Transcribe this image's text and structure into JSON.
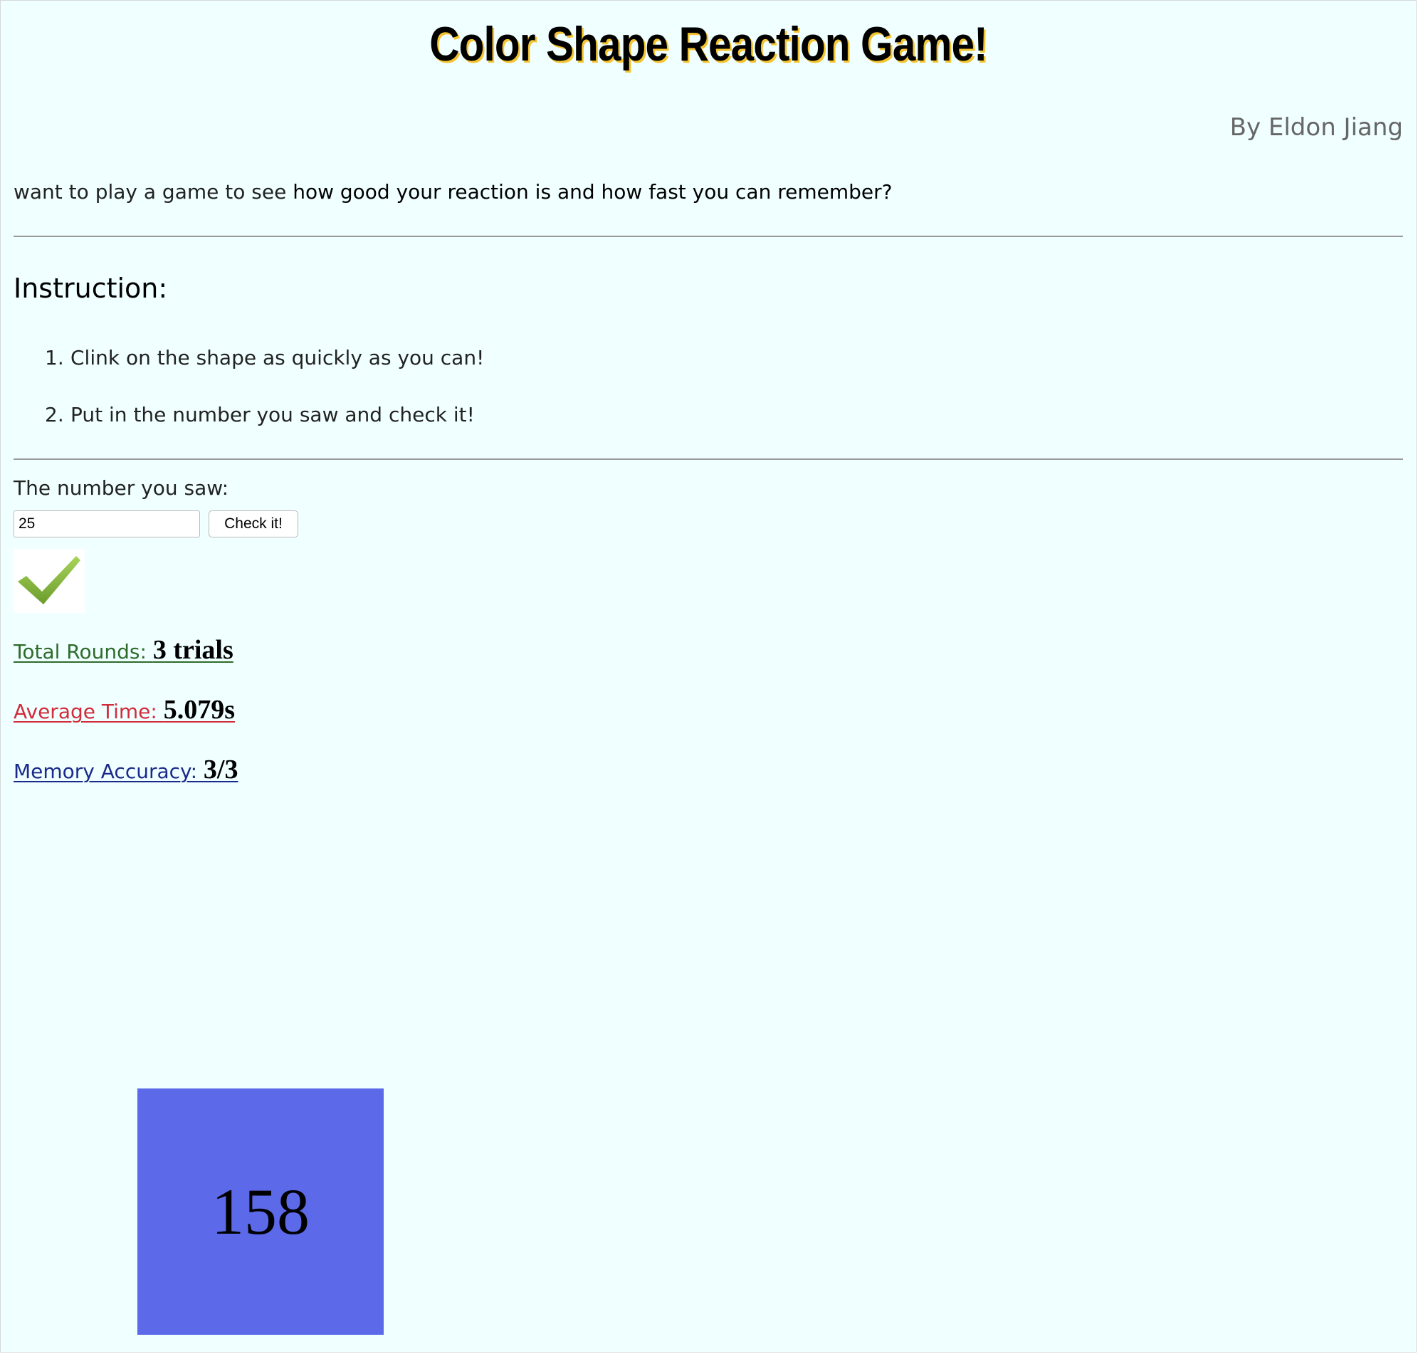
{
  "header": {
    "title": "Color Shape Reaction Game!",
    "byline": "By Eldon Jiang"
  },
  "intro": {
    "lead": "want to play a game to see ",
    "emphasis": "how good your reaction is and how fast you can remember?"
  },
  "instructions": {
    "heading": "Instruction:",
    "items": [
      {
        "number": "1.",
        "text": "Clink on the shape as quickly as you can!"
      },
      {
        "number": "2.",
        "text": "Put in the number you saw and check it!"
      }
    ]
  },
  "input": {
    "label": "The number you saw:",
    "value": "25",
    "button_label": "Check it!"
  },
  "result": {
    "icon": "checkmark-icon",
    "status": "correct"
  },
  "stats": {
    "rounds_label": "Total Rounds:",
    "rounds_value": "3 trials",
    "time_label": "Average Time:",
    "time_value": "5.079s",
    "accuracy_label": "Memory Accuracy:",
    "accuracy_value": "3/3"
  },
  "shape": {
    "number": "158",
    "color": "#5c6aea"
  },
  "colors": {
    "background": "#f0ffff",
    "title_shadow": "#f4c430",
    "rounds": "#2f6b2a",
    "time": "#d22b3a",
    "accuracy": "#1a2a8a"
  }
}
